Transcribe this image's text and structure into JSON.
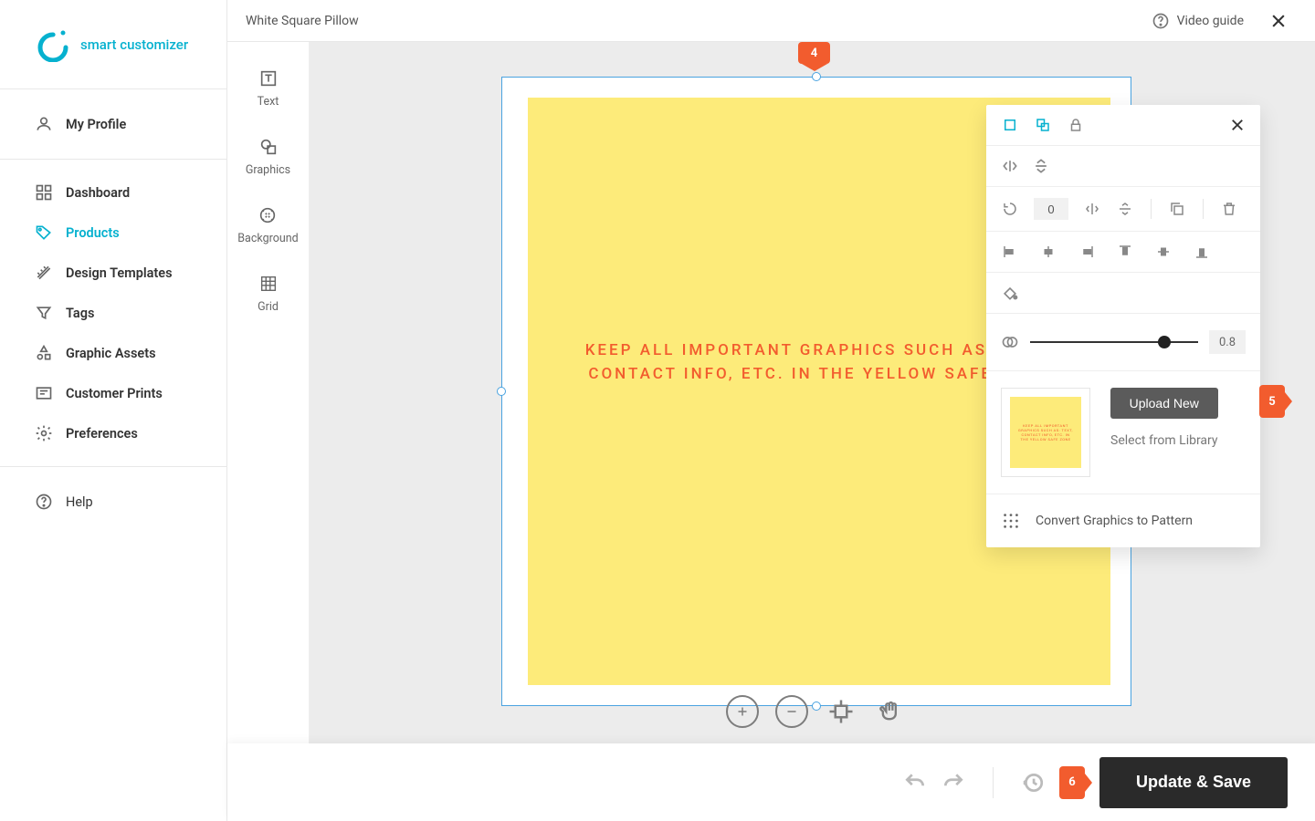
{
  "brand": {
    "name": "smart customizer"
  },
  "header": {
    "title": "White Square Pillow",
    "video_guide": "Video guide"
  },
  "sidebar": {
    "profile": "My Profile",
    "items": [
      "Dashboard",
      "Products",
      "Design Templates",
      "Tags",
      "Graphic Assets",
      "Customer Prints",
      "Preferences"
    ],
    "active_index": 1,
    "help": "Help"
  },
  "tools": [
    "Text",
    "Graphics",
    "Background",
    "Grid"
  ],
  "canvas": {
    "safe_text": "KEEP ALL IMPORTANT GRAPHICS SUCH AS: TEXT, CONTACT INFO, ETC. IN THE YELLOW SAFE ZONE"
  },
  "badges": {
    "top": "4",
    "opacity": "5",
    "footer": "6"
  },
  "panel": {
    "rotation": "0",
    "opacity_value": "0.8",
    "opacity_fraction": 0.8,
    "upload_new": "Upload New",
    "select_library": "Select from Library",
    "convert_pattern": "Convert Graphics to Pattern"
  },
  "footer": {
    "save_label": "Update & Save"
  }
}
